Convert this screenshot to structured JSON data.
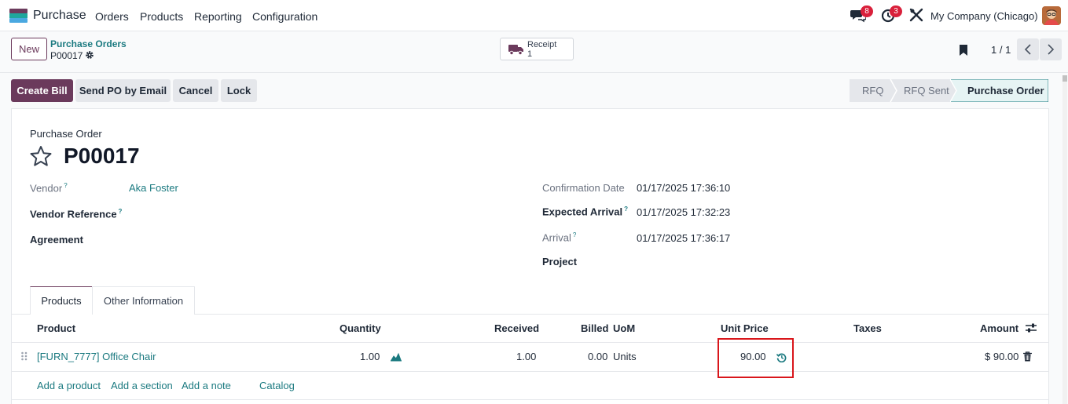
{
  "navbar": {
    "app_name": "Purchase",
    "menu": [
      "Orders",
      "Products",
      "Reporting",
      "Configuration"
    ],
    "messages_count": "8",
    "activities_count": "3",
    "company": "My Company (Chicago)"
  },
  "control_panel": {
    "new_label": "New",
    "breadcrumb": "Purchase Orders",
    "record_name": "P00017",
    "smart_button": {
      "label": "Receipt",
      "count": "1"
    },
    "pager": "1 / 1"
  },
  "actions": {
    "create_bill": "Create Bill",
    "send_po": "Send PO by Email",
    "cancel": "Cancel",
    "lock": "Lock"
  },
  "statusbar": {
    "steps": [
      "RFQ",
      "RFQ Sent",
      "Purchase Order"
    ],
    "current": "Purchase Order"
  },
  "form": {
    "doc_type": "Purchase Order",
    "doc_name": "P00017",
    "vendor_label": "Vendor",
    "vendor_value": "Aka Foster",
    "vendor_reference_label": "Vendor Reference",
    "agreement_label": "Agreement",
    "confirmation_date_label": "Confirmation Date",
    "confirmation_date_value": "01/17/2025 17:36:10",
    "expected_arrival_label": "Expected Arrival",
    "expected_arrival_value": "01/17/2025 17:32:23",
    "arrival_label": "Arrival",
    "arrival_value": "01/17/2025 17:36:17",
    "project_label": "Project",
    "help_mark": "?"
  },
  "tabs": [
    "Products",
    "Other Information"
  ],
  "table": {
    "columns": {
      "product": "Product",
      "quantity": "Quantity",
      "received": "Received",
      "billed": "Billed",
      "uom": "UoM",
      "unit_price": "Unit Price",
      "taxes": "Taxes",
      "amount": "Amount"
    },
    "rows": [
      {
        "product": "[FURN_7777] Office Chair",
        "quantity": "1.00",
        "received": "1.00",
        "billed": "0.00",
        "uom": "Units",
        "unit_price": "90.00",
        "taxes": "",
        "amount": "$ 90.00"
      }
    ],
    "add_links": [
      "Add a product",
      "Add a section",
      "Add a note",
      "Catalog"
    ]
  },
  "colors": {
    "brand": "#6b3a5c",
    "link": "#1b7a80",
    "badge": "#d9203b",
    "highlight": "#d9161b"
  }
}
